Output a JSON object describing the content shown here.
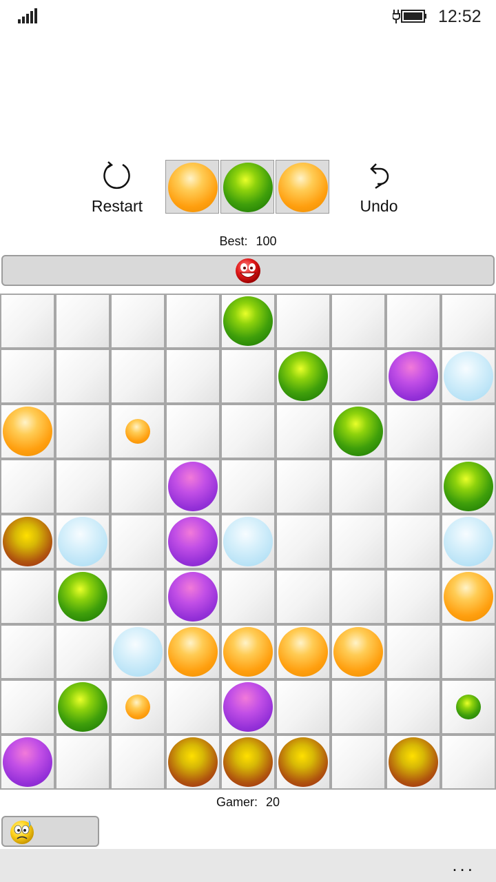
{
  "status_bar": {
    "time": "12:52",
    "signal_icon": "signal-bars-icon",
    "battery_icon": "battery-charging-icon"
  },
  "controls": {
    "restart_label": "Restart",
    "restart_icon": "refresh-icon",
    "undo_label": "Undo",
    "undo_icon": "undo-arrow-icon",
    "next_balls": [
      "orange",
      "green",
      "orange"
    ]
  },
  "best": {
    "label": "Best:",
    "value": "100",
    "marker_icon": "red-smiley-face-icon",
    "progress_fraction": 0.5
  },
  "gamer": {
    "label": "Gamer:",
    "value": "20",
    "marker_icon": "worried-yellow-face-icon",
    "progress_fraction": 0.2
  },
  "board": {
    "columns": 9,
    "rows": 9,
    "balls": [
      {
        "row": 0,
        "col": 4,
        "color": "green",
        "size": "large"
      },
      {
        "row": 1,
        "col": 5,
        "color": "green",
        "size": "large"
      },
      {
        "row": 1,
        "col": 7,
        "color": "purple",
        "size": "large"
      },
      {
        "row": 1,
        "col": 8,
        "color": "lightblue",
        "size": "large"
      },
      {
        "row": 2,
        "col": 0,
        "color": "orange",
        "size": "large"
      },
      {
        "row": 2,
        "col": 2,
        "color": "orange",
        "size": "small"
      },
      {
        "row": 2,
        "col": 6,
        "color": "green",
        "size": "large"
      },
      {
        "row": 3,
        "col": 3,
        "color": "purple",
        "size": "large"
      },
      {
        "row": 3,
        "col": 8,
        "color": "green",
        "size": "large"
      },
      {
        "row": 4,
        "col": 0,
        "color": "brown",
        "size": "large"
      },
      {
        "row": 4,
        "col": 1,
        "color": "lightblue",
        "size": "large"
      },
      {
        "row": 4,
        "col": 3,
        "color": "purple",
        "size": "large"
      },
      {
        "row": 4,
        "col": 4,
        "color": "lightblue",
        "size": "large"
      },
      {
        "row": 4,
        "col": 8,
        "color": "lightblue",
        "size": "large"
      },
      {
        "row": 5,
        "col": 1,
        "color": "green",
        "size": "large"
      },
      {
        "row": 5,
        "col": 3,
        "color": "purple",
        "size": "large"
      },
      {
        "row": 5,
        "col": 8,
        "color": "orange",
        "size": "large"
      },
      {
        "row": 6,
        "col": 2,
        "color": "lightblue",
        "size": "large"
      },
      {
        "row": 6,
        "col": 3,
        "color": "orange",
        "size": "large"
      },
      {
        "row": 6,
        "col": 4,
        "color": "orange",
        "size": "large"
      },
      {
        "row": 6,
        "col": 5,
        "color": "orange",
        "size": "large"
      },
      {
        "row": 6,
        "col": 6,
        "color": "orange",
        "size": "large"
      },
      {
        "row": 7,
        "col": 1,
        "color": "green",
        "size": "large"
      },
      {
        "row": 7,
        "col": 2,
        "color": "orange",
        "size": "small"
      },
      {
        "row": 7,
        "col": 4,
        "color": "purple",
        "size": "large"
      },
      {
        "row": 7,
        "col": 8,
        "color": "green",
        "size": "small"
      },
      {
        "row": 8,
        "col": 0,
        "color": "purple",
        "size": "large"
      },
      {
        "row": 8,
        "col": 3,
        "color": "brown",
        "size": "large"
      },
      {
        "row": 8,
        "col": 4,
        "color": "brown",
        "size": "large"
      },
      {
        "row": 8,
        "col": 5,
        "color": "brown",
        "size": "large"
      },
      {
        "row": 8,
        "col": 7,
        "color": "brown",
        "size": "large"
      }
    ]
  },
  "app_bar": {
    "more_label": "..."
  }
}
